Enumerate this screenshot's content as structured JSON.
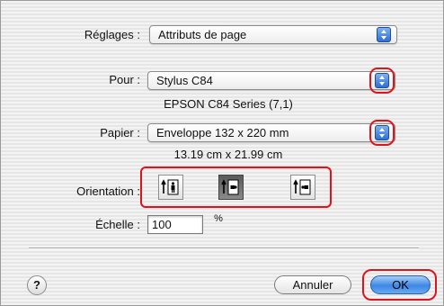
{
  "settings": {
    "label": "Réglages :",
    "value": "Attributs de page"
  },
  "format_for": {
    "label": "Pour :",
    "value": "Stylus C84",
    "printer_info": "EPSON C84 Series (7,1)"
  },
  "paper": {
    "label": "Papier :",
    "value": "Enveloppe 132 x 220 mm",
    "dimensions": "13.19 cm x 21.99 cm"
  },
  "orientation": {
    "label": "Orientation :",
    "options": [
      "portrait",
      "landscape",
      "landscape-reversed"
    ],
    "selected": "landscape"
  },
  "scale": {
    "label": "Échelle :",
    "value": "100",
    "unit": "%"
  },
  "buttons": {
    "help": "?",
    "cancel": "Annuler",
    "ok": "OK"
  },
  "colors": {
    "highlight": "#e0121b",
    "accent": "#3c87e6"
  }
}
